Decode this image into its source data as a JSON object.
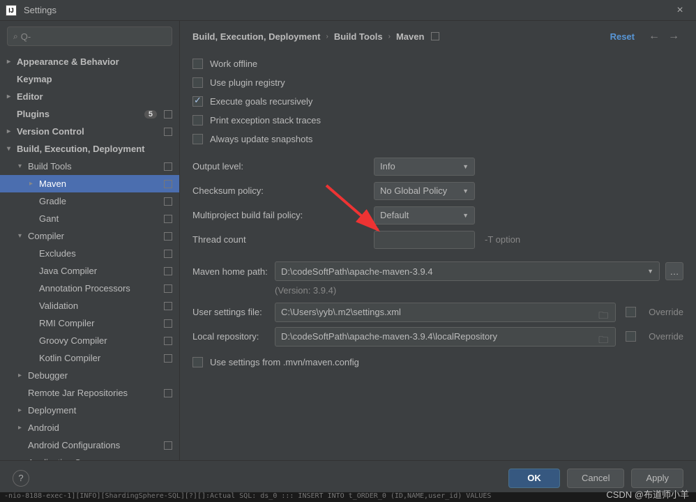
{
  "window": {
    "title": "Settings"
  },
  "search": {
    "placeholder": "Q-"
  },
  "sidebar": {
    "items": [
      {
        "label": "Appearance & Behavior",
        "arrow": "right",
        "bold": true,
        "indent": 0,
        "tail": false
      },
      {
        "label": "Keymap",
        "arrow": "none",
        "bold": true,
        "indent": 0,
        "tail": false
      },
      {
        "label": "Editor",
        "arrow": "right",
        "bold": true,
        "indent": 0,
        "tail": false
      },
      {
        "label": "Plugins",
        "arrow": "none",
        "bold": true,
        "indent": 0,
        "tail": true,
        "badge": "5"
      },
      {
        "label": "Version Control",
        "arrow": "right",
        "bold": true,
        "indent": 0,
        "tail": true
      },
      {
        "label": "Build, Execution, Deployment",
        "arrow": "down",
        "bold": true,
        "indent": 0,
        "tail": false
      },
      {
        "label": "Build Tools",
        "arrow": "down",
        "bold": false,
        "indent": 1,
        "tail": true
      },
      {
        "label": "Maven",
        "arrow": "right",
        "bold": false,
        "indent": 2,
        "tail": true,
        "selected": true
      },
      {
        "label": "Gradle",
        "arrow": "none",
        "bold": false,
        "indent": 2,
        "tail": true
      },
      {
        "label": "Gant",
        "arrow": "none",
        "bold": false,
        "indent": 2,
        "tail": true
      },
      {
        "label": "Compiler",
        "arrow": "down",
        "bold": false,
        "indent": 1,
        "tail": true
      },
      {
        "label": "Excludes",
        "arrow": "none",
        "bold": false,
        "indent": 2,
        "tail": true
      },
      {
        "label": "Java Compiler",
        "arrow": "none",
        "bold": false,
        "indent": 2,
        "tail": true
      },
      {
        "label": "Annotation Processors",
        "arrow": "none",
        "bold": false,
        "indent": 2,
        "tail": true
      },
      {
        "label": "Validation",
        "arrow": "none",
        "bold": false,
        "indent": 2,
        "tail": true
      },
      {
        "label": "RMI Compiler",
        "arrow": "none",
        "bold": false,
        "indent": 2,
        "tail": true
      },
      {
        "label": "Groovy Compiler",
        "arrow": "none",
        "bold": false,
        "indent": 2,
        "tail": true
      },
      {
        "label": "Kotlin Compiler",
        "arrow": "none",
        "bold": false,
        "indent": 2,
        "tail": true
      },
      {
        "label": "Debugger",
        "arrow": "right",
        "bold": false,
        "indent": 1,
        "tail": false
      },
      {
        "label": "Remote Jar Repositories",
        "arrow": "none",
        "bold": false,
        "indent": 1,
        "tail": true
      },
      {
        "label": "Deployment",
        "arrow": "right",
        "bold": false,
        "indent": 1,
        "tail": false
      },
      {
        "label": "Android",
        "arrow": "right",
        "bold": false,
        "indent": 1,
        "tail": false
      },
      {
        "label": "Android Configurations",
        "arrow": "none",
        "bold": false,
        "indent": 1,
        "tail": true
      },
      {
        "label": "Application Servers",
        "arrow": "none",
        "bold": false,
        "indent": 1,
        "tail": false
      }
    ]
  },
  "breadcrumb": {
    "p0": "Build, Execution, Deployment",
    "p1": "Build Tools",
    "p2": "Maven",
    "reset": "Reset"
  },
  "checks": {
    "work_offline": "Work offline",
    "plugin_registry": "Use plugin registry",
    "exec_recursive": "Execute goals recursively",
    "print_exception": "Print exception stack traces",
    "always_update": "Always update snapshots",
    "use_mvn_config": "Use settings from .mvn/maven.config"
  },
  "fields": {
    "output_level": {
      "label": "Output level:",
      "value": "Info"
    },
    "checksum": {
      "label": "Checksum policy:",
      "value": "No Global Policy"
    },
    "fail_policy": {
      "label": "Multiproject build fail policy:",
      "value": "Default"
    },
    "thread_count": {
      "label": "Thread count",
      "value": "",
      "hint": "-T option"
    },
    "maven_home": {
      "label": "Maven home path:",
      "value": "D:\\codeSoftPath\\apache-maven-3.9.4",
      "version": "(Version: 3.9.4)"
    },
    "user_settings": {
      "label": "User settings file:",
      "value": "C:\\Users\\yyb\\.m2\\settings.xml",
      "override": "Override"
    },
    "local_repo": {
      "label": "Local repository:",
      "value": "D:\\codeSoftPath\\apache-maven-3.9.4\\localRepository",
      "override": "Override"
    }
  },
  "buttons": {
    "ok": "OK",
    "cancel": "Cancel",
    "apply": "Apply"
  },
  "watermark": "CSDN @布道师小羊",
  "console": "-nio-8188-exec-1][INFO][ShardingSphere-SQL][?][]:Actual SQL: ds_0 ::: INSERT INTO t_ORDER_0 (ID,NAME,user_id) VALUES"
}
